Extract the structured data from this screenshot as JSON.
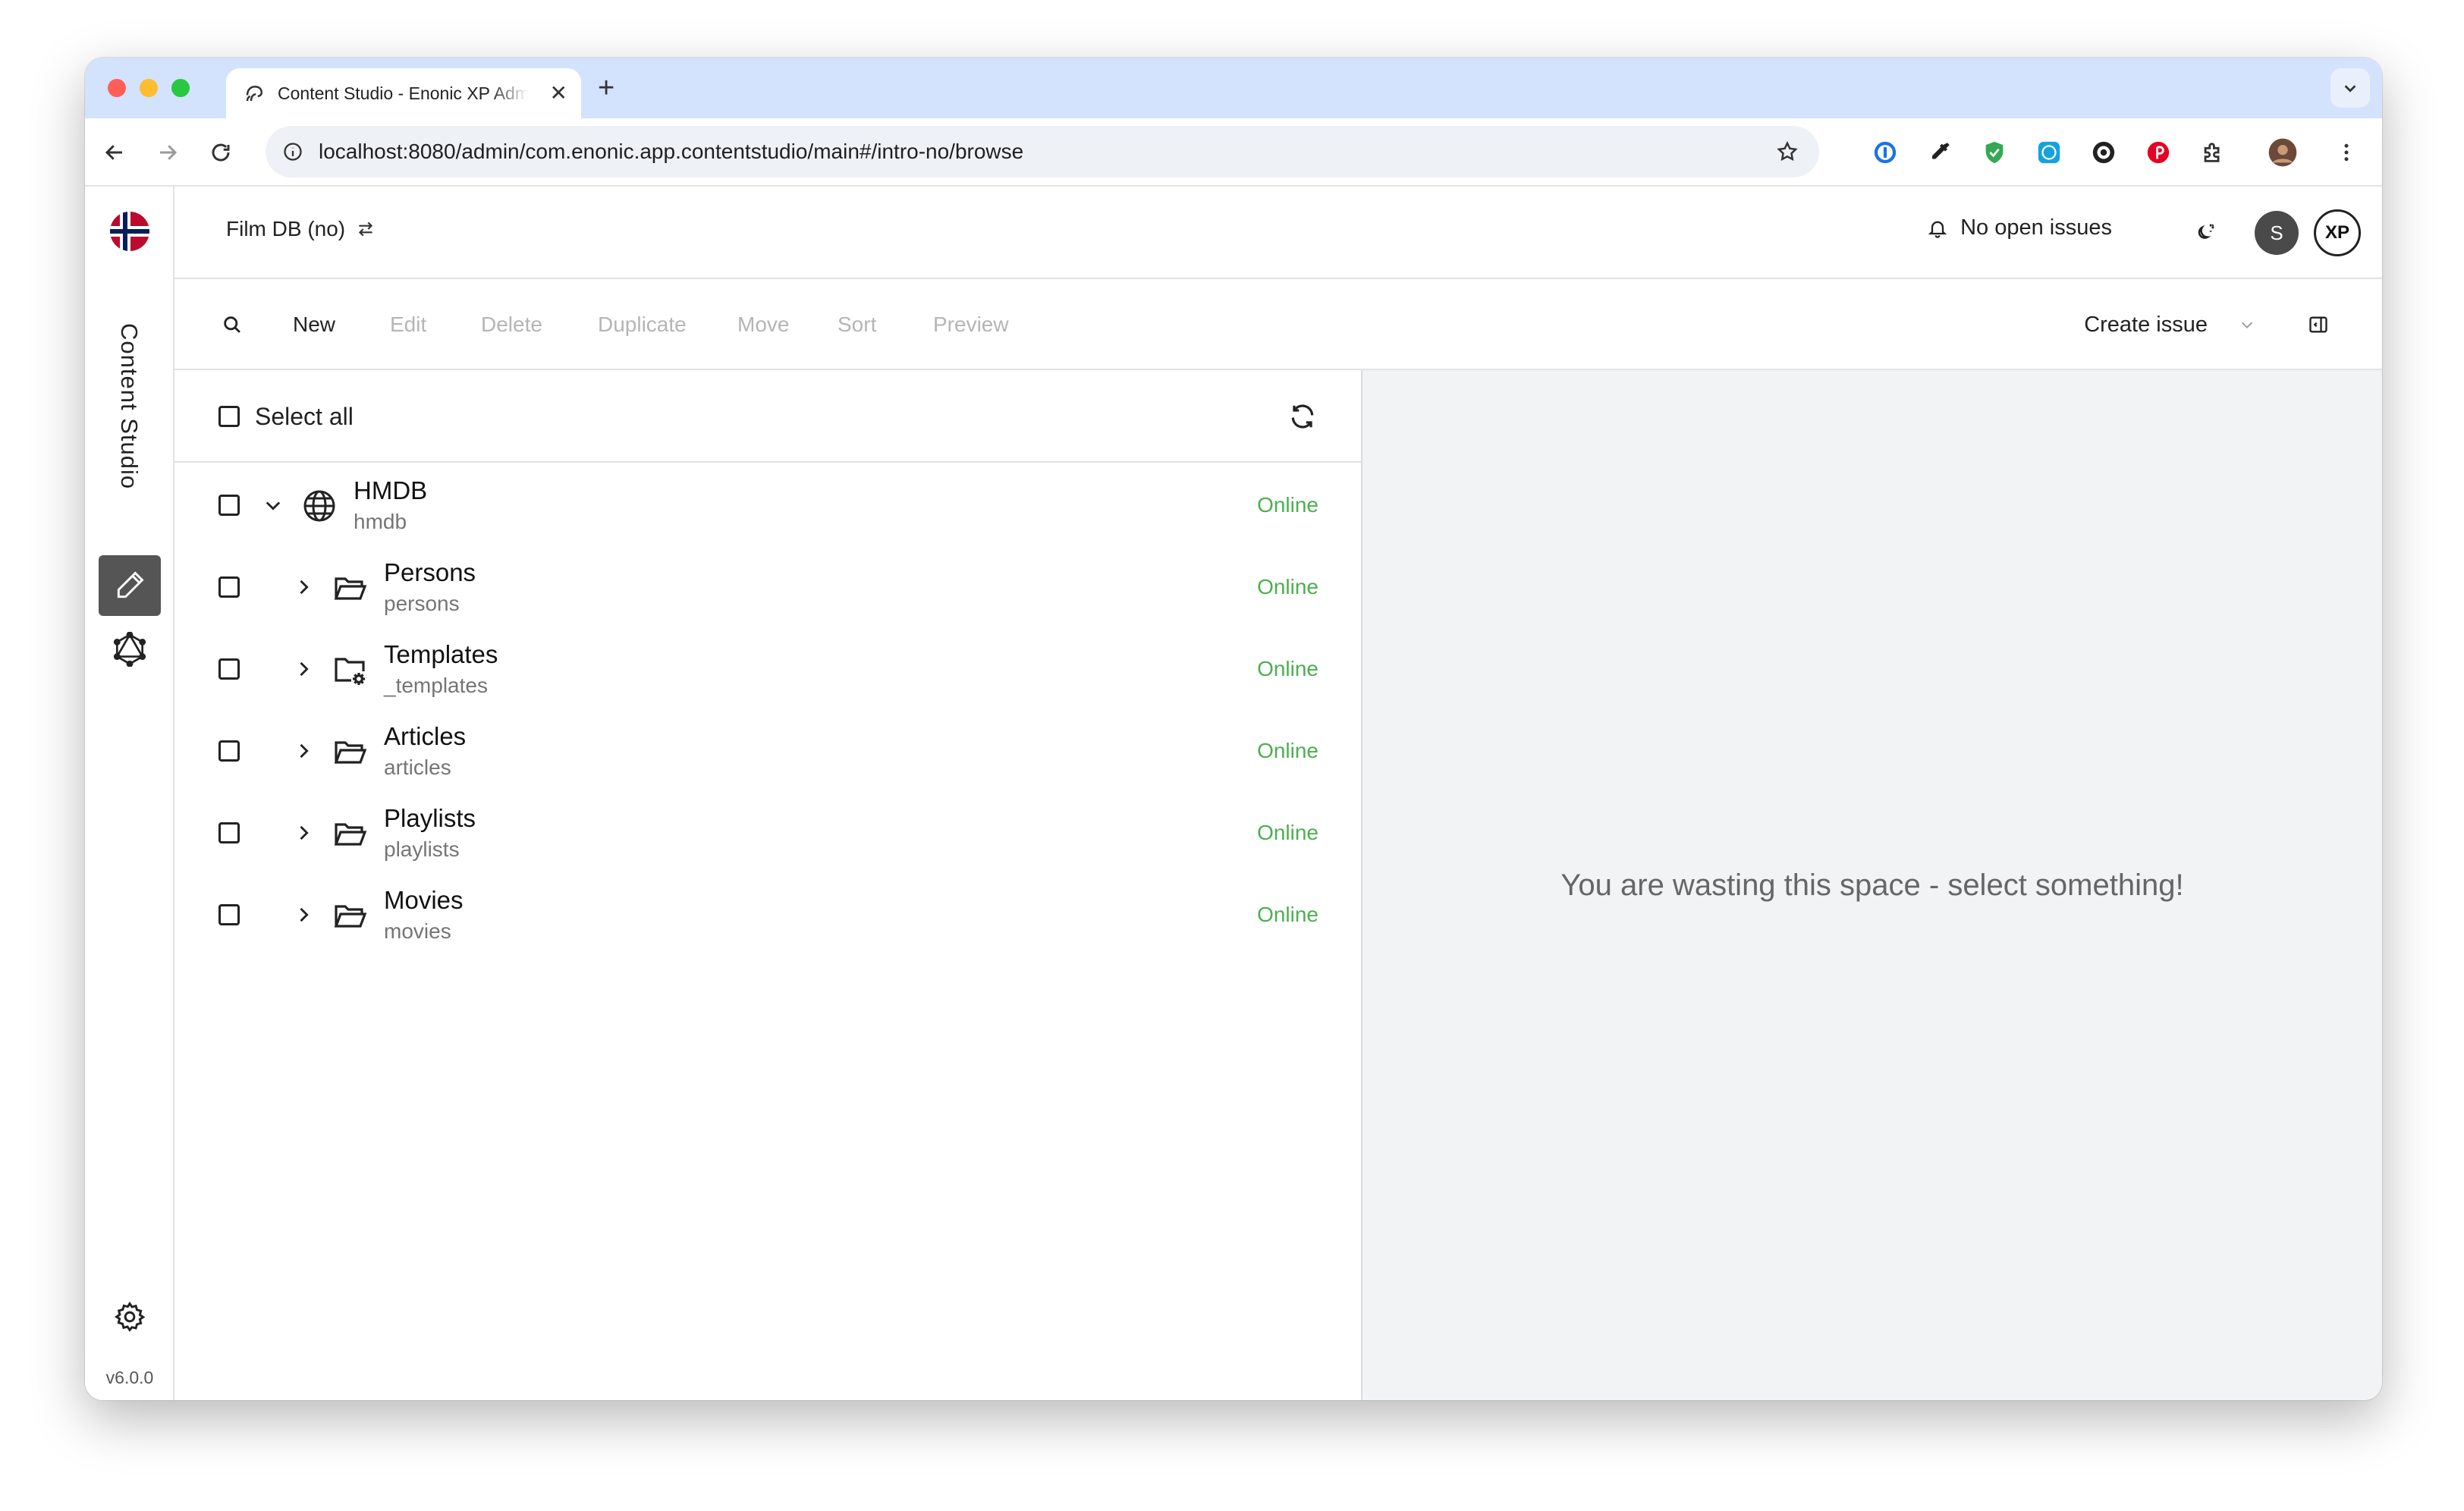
{
  "browser": {
    "tab_title": "Content Studio - Enonic XP Admin",
    "url": "localhost:8080/admin/com.enonic.app.contentstudio/main#/intro-no/browse"
  },
  "sidebar": {
    "app_name": "Content Studio",
    "version": "v6.0.0"
  },
  "header": {
    "project_name": "Film DB (no)",
    "issues_label": "No open issues",
    "avatar_initial": "S",
    "xp_logo": "XP"
  },
  "actions": {
    "new": "New",
    "edit": "Edit",
    "delete": "Delete",
    "duplicate": "Duplicate",
    "move": "Move",
    "sort": "Sort",
    "preview": "Preview",
    "create_issue": "Create issue"
  },
  "list": {
    "select_all": "Select all",
    "items": [
      {
        "title": "HMDB",
        "path": "hmdb",
        "status": "Online",
        "icon": "globe-icon",
        "expanded": true
      },
      {
        "title": "Persons",
        "path": "persons",
        "status": "Online",
        "icon": "folder-icon",
        "expanded": false
      },
      {
        "title": "Templates",
        "path": "_templates",
        "status": "Online",
        "icon": "template-folder-icon",
        "expanded": false
      },
      {
        "title": "Articles",
        "path": "articles",
        "status": "Online",
        "icon": "folder-icon",
        "expanded": false
      },
      {
        "title": "Playlists",
        "path": "playlists",
        "status": "Online",
        "icon": "folder-icon",
        "expanded": false
      },
      {
        "title": "Movies",
        "path": "movies",
        "status": "Online",
        "icon": "folder-icon",
        "expanded": false
      }
    ]
  },
  "preview_panel": {
    "empty_message": "You are wasting this space - select something!"
  },
  "colors": {
    "online": "#4caf50",
    "tabbar": "#d3e3fd",
    "disabled_action": "#b5b5b5",
    "preview_bg": "#f1f3f4"
  }
}
